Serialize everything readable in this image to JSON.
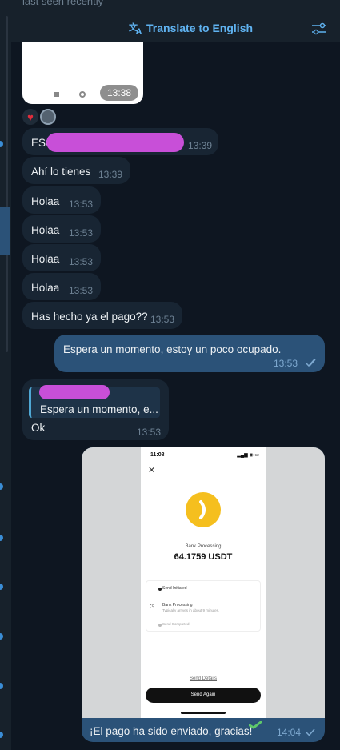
{
  "header": {
    "last_seen": "last seen recently",
    "translate_label": "Translate to English"
  },
  "image_message": {
    "time": "13:38"
  },
  "messages": [
    {
      "text": "ES6",
      "time": "13:39"
    },
    {
      "text": "Ahí lo tienes",
      "time": "13:39"
    },
    {
      "text": "Holaa",
      "time": "13:53"
    },
    {
      "text": "Holaa",
      "time": "13:53"
    },
    {
      "text": "Holaa",
      "time": "13:53"
    },
    {
      "text": "Holaa",
      "time": "13:53"
    },
    {
      "text": "Has hecho ya el pago??",
      "time": "13:53"
    }
  ],
  "outgoing": {
    "text": "Espera un momento, estoy un poco ocupado.",
    "time": "13:53"
  },
  "reply_message": {
    "quote": "Espera un momento, e...",
    "text": "Ok",
    "time": "13:53"
  },
  "photo_message": {
    "phone_time": "11:08",
    "status_label": "Bank Processing",
    "amount": "64.1759 USDT",
    "steps": [
      {
        "label": "Send Initiated"
      },
      {
        "label": "Bank Processing",
        "sub": "Typically arrives in about 9 minutes."
      },
      {
        "label": "Send Completed"
      }
    ],
    "details_link": "Send Details",
    "send_again": "Send Again",
    "caption": "¡El pago ha sido enviado, gracias!",
    "time": "14:04"
  },
  "colors": {
    "background": "#0e1621",
    "incoming_bubble": "#182533",
    "outgoing_bubble": "#2b5278",
    "accent": "#5fb2f0"
  }
}
